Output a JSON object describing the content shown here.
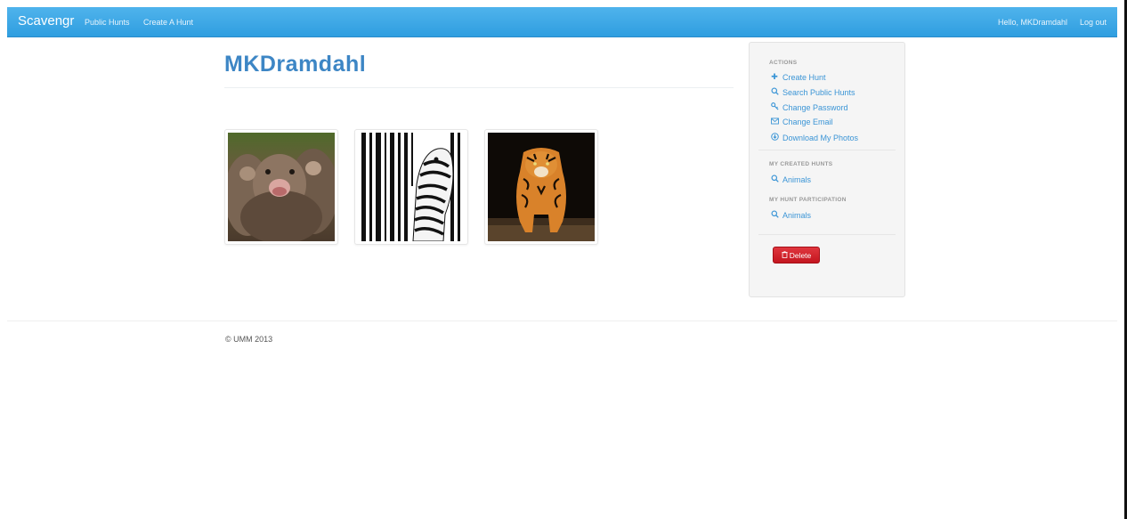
{
  "nav": {
    "brand": "Scavengr",
    "links": [
      "Public Hunts",
      "Create A Hunt"
    ],
    "greeting": "Hello, MKDramdahl",
    "logout": "Log out"
  },
  "main": {
    "title": "MKDramdahl",
    "photos": [
      {
        "icon": "otters-photo"
      },
      {
        "icon": "zebra-photo"
      },
      {
        "icon": "tiger-photo"
      }
    ]
  },
  "sidebar": {
    "actions_header": "ACTIONS",
    "actions": [
      {
        "label": "Create Hunt",
        "icon": "plus-icon"
      },
      {
        "label": "Search Public Hunts",
        "icon": "search-icon"
      },
      {
        "label": "Change Password",
        "icon": "key-icon"
      },
      {
        "label": "Change Email",
        "icon": "envelope-icon"
      },
      {
        "label": "Download My Photos",
        "icon": "download-icon"
      }
    ],
    "created_header": "MY CREATED HUNTS",
    "created_hunts": [
      {
        "label": "Animals",
        "icon": "search-icon"
      }
    ],
    "participation_header": "MY HUNT PARTICIPATION",
    "participation_hunts": [
      {
        "label": "Animals",
        "icon": "search-icon"
      }
    ],
    "delete_label": "Delete"
  },
  "footer": {
    "copyright": "© UMM 2013"
  },
  "colors": {
    "navbar": "#2f9ee0",
    "title": "#3d86c5",
    "link": "#3b95d6",
    "danger": "#c4161f"
  }
}
